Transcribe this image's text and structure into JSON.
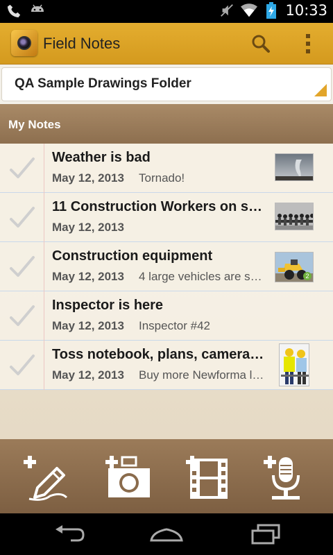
{
  "status_bar": {
    "time": "10:33",
    "icons": [
      "phone-icon",
      "android-icon",
      "mute-icon",
      "wifi-icon",
      "battery-charging-icon"
    ]
  },
  "action_bar": {
    "title": "Field Notes",
    "app_icon": "camera-lens-icon",
    "actions": [
      "search-icon",
      "overflow-menu-icon"
    ]
  },
  "folder_spinner": {
    "selected": "QA Sample Drawings Folder"
  },
  "section": {
    "title": "My Notes"
  },
  "notes": [
    {
      "title": "Weather is bad",
      "date": "May 12, 2013",
      "snippet": "Tornado!",
      "thumbnail": "tornado-photo",
      "count": ""
    },
    {
      "title": "11 Construction Workers on s…",
      "date": "May 12, 2013",
      "snippet": "",
      "thumbnail": "workers-beam-photo",
      "count": ""
    },
    {
      "title": "Construction equipment",
      "date": "May 12, 2013",
      "snippet": "4 large vehicles are s…",
      "thumbnail": "loader-photo",
      "count": "2"
    },
    {
      "title": "Inspector is here",
      "date": "May 12, 2013",
      "snippet": "Inspector #42",
      "thumbnail": "",
      "count": ""
    },
    {
      "title": "Toss notebook, plans, camera…",
      "date": "May 12, 2013",
      "snippet": "Buy more Newforma l…",
      "thumbnail": "engineers-photo",
      "count": ""
    }
  ],
  "tray_actions": [
    "new-text-note-icon",
    "new-photo-note-icon",
    "new-video-note-icon",
    "new-audio-note-icon"
  ],
  "nav": [
    "back-icon",
    "home-icon",
    "recent-apps-icon"
  ],
  "colors": {
    "action_bar": "#dca428",
    "section_header": "#9b7b59",
    "tray": "#8a6b4c",
    "row_rule": "#c9d8ea",
    "margin_rule": "#ecc7c3",
    "spinner_accent": "#e2a52a"
  }
}
